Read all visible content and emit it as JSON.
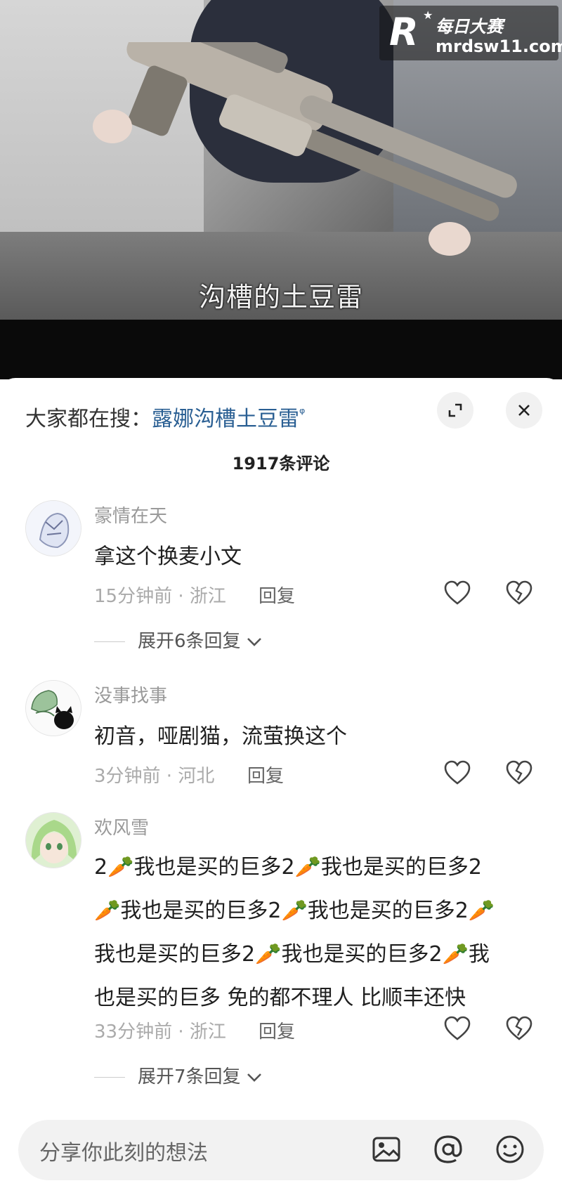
{
  "video": {
    "subtitle": "沟槽的土豆雷"
  },
  "watermark": {
    "logo": "R",
    "name": "每日大赛",
    "url": "mrdsw11.com"
  },
  "sheet": {
    "search_prefix": "大家都在搜：",
    "search_term": "露娜沟槽土豆雷",
    "comment_count": "1917条评论"
  },
  "comments": [
    {
      "user": "豪情在天",
      "text": "拿这个换麦小文",
      "time_location": "15分钟前 · 浙江",
      "reply": "回复",
      "expand": "展开6条回复"
    },
    {
      "user": "没事找事",
      "text": "初音，哑剧猫，流萤换这个",
      "time_location": "3分钟前 · 河北",
      "reply": "回复"
    },
    {
      "user": "欢风雪",
      "text_lines": [
        "2🥕我也是买的巨多2🥕我也是买的巨多2",
        "🥕我也是买的巨多2🥕我也是买的巨多2🥕",
        "我也是买的巨多2🥕我也是买的巨多2🥕我",
        "也是买的巨多 免的都不理人 比顺丰还快"
      ],
      "time_location": "33分钟前 · 浙江",
      "reply": "回复",
      "expand": "展开7条回复"
    }
  ],
  "input": {
    "placeholder": "分享你此刻的想法"
  },
  "icons": {
    "expand": "expand-icon",
    "close": "close-icon",
    "like": "heart-icon",
    "dislike": "broken-heart-icon",
    "image": "image-icon",
    "mention": "at-icon",
    "emoji": "emoji-icon"
  }
}
